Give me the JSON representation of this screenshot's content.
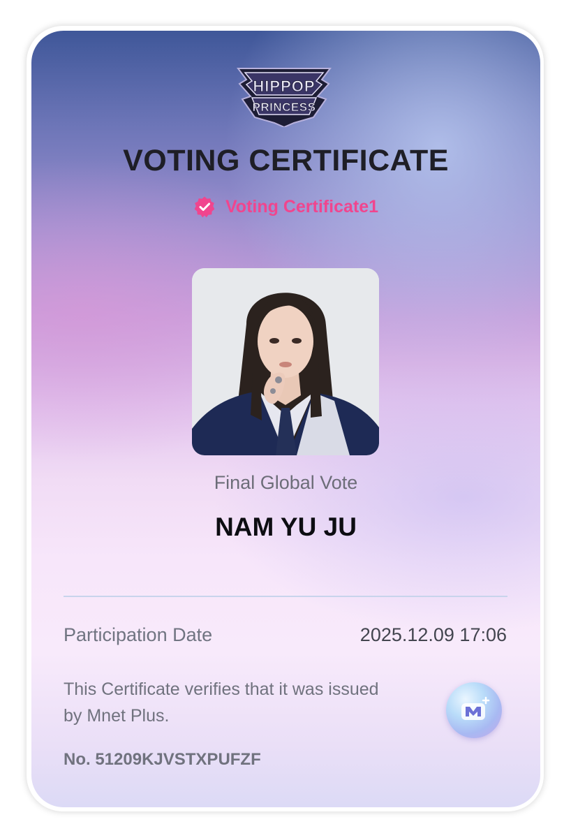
{
  "certificate": {
    "logo": {
      "line1": "HIPPOP",
      "line2": "PRINCESS"
    },
    "title": "VOTING CERTIFICATE",
    "badge": {
      "icon": "verified-badge-icon",
      "label": "Voting Certificate1",
      "color": "#f0458e"
    },
    "photo": {
      "description_icon": "portrait-photo"
    },
    "vote_name": "Final Global Vote",
    "candidate_name": "NAM YU JU",
    "participation": {
      "label": "Participation Date",
      "value": "2025.12.09 17:06"
    },
    "verification_text": "This Certificate verifies that it was issued by Mnet Plus.",
    "mnet_logo_icon": "mnet-plus-logo-icon",
    "serial_number": "No. 51209KJVSTXPUFZF"
  }
}
